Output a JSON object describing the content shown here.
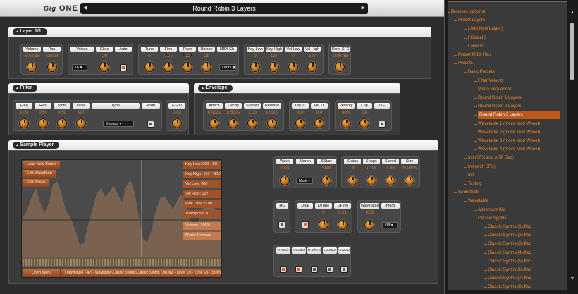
{
  "header": {
    "logo": "ONE",
    "logo_mark": "Gig",
    "preset_name": "Round Robin 3 Layers",
    "prev_arrow": "◀",
    "next_arrow": "▶"
  },
  "layer": {
    "title": "Layer 1/1",
    "groups": [
      {
        "labels": [
          "Volume",
          "Pan"
        ],
        "values": [
          "-6.02 dB",
          "Center"
        ]
      },
      {
        "labels": [
          "Voices",
          "Glide",
          "Auto"
        ],
        "values": [
          "",
          "Off",
          ""
        ],
        "voices_value": "16"
      },
      {
        "labels": [
          "Tune",
          "Fine Tune",
          "Pitch Bend",
          "Unison",
          "MIDI Ch"
        ],
        "values": [
          "0",
          "0.00",
          "12",
          "Off",
          ""
        ],
        "midi_value": "Omni"
      },
      {
        "labels": [
          "Key Low",
          "Key High",
          "Vel Low",
          "Vel High"
        ],
        "values": [
          "0",
          "127",
          "0",
          "127"
        ]
      },
      {
        "labels": [
          "Send SFX"
        ],
        "values": [
          "0.00 dB"
        ]
      }
    ]
  },
  "filter": {
    "title": "Filter",
    "labels": [
      "Freq",
      "Res",
      "Smth",
      "Drive",
      "Type",
      "48db"
    ],
    "values": [
      "1.00",
      "0.50",
      "0.50",
      "Off"
    ],
    "type_value": "Bypass",
    "fenv_label": "F.Env",
    "fenv_value": "0.00"
  },
  "envelope": {
    "title": "Envelope",
    "labels": [
      "Attack",
      "Decay",
      "Sustain",
      "Release"
    ],
    "values": [
      "0.002s",
      "0.500s",
      "1.00",
      "1.000s"
    ],
    "key_labels": [
      "Key Tr.",
      "Vel Tr."
    ],
    "key_values": [
      "0.0",
      "0.0"
    ],
    "vel_labels": [
      "Velocity",
      "Clip",
      "L/E"
    ],
    "vel_values": [
      "80%",
      "Off"
    ]
  },
  "sample": {
    "title": "Sample Player",
    "wave_buttons": [
      "Load New Sound",
      "Edit Waveform",
      "Edit Zones"
    ],
    "info": [
      "Key Low: 000 - C0",
      "Key High: 127 - G10",
      "Vel Low: 000",
      "Vel High: 127",
      "Fine Tune: 0.00",
      "Transpose: 0",
      "Volume: 100%",
      "Mode: Forward"
    ],
    "open_menu": "Open Menu",
    "file_path": "[ Wavetable File ] - Wavetable\\Classic Synths\\Classic Synths (34).flac - Layer 1/3 - Zone 1/1 - 33 Waves",
    "g1": {
      "labels": [
        "Wave",
        "Morph",
        "SStart"
      ],
      "values": [
        "1.00",
        "",
        "Start"
      ],
      "dd": "Multi"
    },
    "g2": {
      "labels": [
        "Grains",
        "Shape",
        "Speed",
        "Size"
      ],
      "values": [
        "Off",
        "0.00",
        "1.00",
        "N.Pitch"
      ]
    },
    "hq": "HQ",
    "g3": {
      "labels": [
        "Dual",
        "DTune",
        "DFine"
      ],
      "values": [
        "",
        "0",
        "0.21"
      ]
    },
    "g4": {
      "labels": [
        "Wavetable",
        "Interp."
      ],
      "values": [
        "0.50",
        ""
      ],
      "dd": "Off"
    },
    "g5": {
      "labels": [
        "R.Robin",
        "K.Switch",
        "M.Wheel",
        "V.SStart",
        "V.Wave"
      ]
    }
  },
  "browser": {
    "items": [
      {
        "text": "Browser (options)",
        "x": 4,
        "sel": false
      },
      {
        "text": "Preset Layers",
        "x": 14,
        "sel": false
      },
      {
        "text": "[ Add New Layer ]",
        "x": 28,
        "sel": false
      },
      {
        "text": "[ Global ]",
        "x": 28,
        "sel": false
      },
      {
        "text": "Layer 01",
        "x": 28,
        "sel": false
      },
      {
        "text": "Preset MIDI Files",
        "x": 14,
        "sel": false
      },
      {
        "text": "Presets",
        "x": 14,
        "sel": false
      },
      {
        "text": "Basic Presets",
        "x": 28,
        "sel": false
      },
      {
        "text": "Filter Velocity",
        "x": 42,
        "sel": false
      },
      {
        "text": "Piano Sequencer",
        "x": 42,
        "sel": false
      },
      {
        "text": "Round Robin 1 Layers",
        "x": 42,
        "sel": false
      },
      {
        "text": "Round Robin 2 Layers",
        "x": 42,
        "sel": false
      },
      {
        "text": "Round Robin 3 Layers",
        "x": 42,
        "sel": true
      },
      {
        "text": "Wavetable 1 (move Mod Wheel)",
        "x": 42,
        "sel": false
      },
      {
        "text": "Wavetable 2 (move Mod Wheel)",
        "x": 42,
        "sel": false
      },
      {
        "text": "Wavetable 3 (move Mod Wheel)",
        "x": 42,
        "sel": false
      },
      {
        "text": "Wavetable 4 (move Mod Wheel)",
        "x": 42,
        "sel": false
      },
      {
        "text": "Init (SFX and ARP Seq)",
        "x": 28,
        "sel": false
      },
      {
        "text": "Init (with SFX)",
        "x": 28,
        "sel": false
      },
      {
        "text": "Init",
        "x": 28,
        "sel": false
      },
      {
        "text": "Testing",
        "x": 28,
        "sel": false
      },
      {
        "text": "SoundSets",
        "x": 14,
        "sel": false
      },
      {
        "text": "Wavetable",
        "x": 28,
        "sel": false
      },
      {
        "text": "Adventure Kid",
        "x": 42,
        "sel": false
      },
      {
        "text": "Classic Synths",
        "x": 42,
        "sel": false
      },
      {
        "text": "Classic Synths (1).flac",
        "x": 56,
        "sel": false
      },
      {
        "text": "Classic Synths (2).flac",
        "x": 56,
        "sel": false
      },
      {
        "text": "Classic Synths (3).flac",
        "x": 56,
        "sel": false
      },
      {
        "text": "Classic Synths (4).flac",
        "x": 56,
        "sel": false
      },
      {
        "text": "Classic Synths (5).flac",
        "x": 56,
        "sel": false
      },
      {
        "text": "Classic Synths (6).flac",
        "x": 56,
        "sel": false
      },
      {
        "text": "Classic Synths (7).flac",
        "x": 56,
        "sel": false
      },
      {
        "text": "Classic Synths (8).flac",
        "x": 56,
        "sel": false
      }
    ]
  }
}
